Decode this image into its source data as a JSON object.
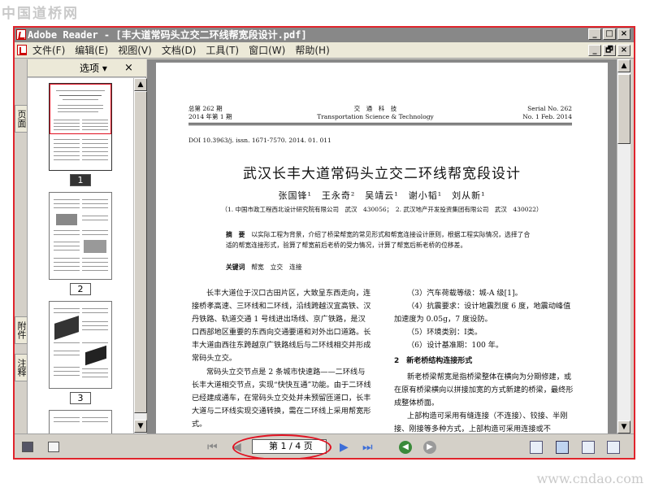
{
  "watermarks": {
    "top": "中国道桥网",
    "bottom": "www.cndao.com"
  },
  "window": {
    "title": "Adobe Reader - [丰大道常码头立交二环线帮宽段设计.pdf]",
    "title_buttons": [
      "_",
      "□",
      "×"
    ],
    "doc_buttons": [
      "_",
      "🗗",
      "×"
    ]
  },
  "menu": [
    "文件(F)",
    "编辑(E)",
    "视图(V)",
    "文档(D)",
    "工具(T)",
    "窗口(W)",
    "帮助(H)"
  ],
  "nav_tabs": [
    "页面",
    "附件",
    "注释"
  ],
  "nav_panel": {
    "options_label": "选项",
    "options_arrow": "▾",
    "close_label": "×",
    "thumbnail_labels": [
      "1",
      "2",
      "3"
    ]
  },
  "document": {
    "header_left": [
      "总第 262 期",
      "2014 年第 1 期"
    ],
    "header_center": [
      "交　通　科　技",
      "Transportation Science & Technology"
    ],
    "header_right": [
      "Serial No. 262",
      "No. 1 Feb. 2014"
    ],
    "doi": "DOI 10.3963/j. issn. 1671-7570. 2014. 01. 011",
    "title": "武汉长丰大道常码头立交二环线帮宽段设计",
    "authors": "张国锋¹　王永奇²　吴靖云¹　谢小韬¹　刘从新¹",
    "affiliation": "（1. 中国市政工程西北设计研究院有限公司　武汉　430056；　2. 武汉地产开发投资集团有限公司　武汉　430022）",
    "abstract_label": "摘　要",
    "abstract": "以实际工程为背景，介绍了桥梁帮宽的常见形式和帮宽连接设计原则，根据工程实际情况，选择了合适的帮宽连接形式，验算了帮宽前后老桥的受力情况，计算了帮宽后新老桥的位移差。",
    "keywords_label": "关键词",
    "keywords": "帮宽　立交　连接",
    "col1_paragraphs": [
      "长丰大道位于汉口古田片区，大致呈东西走向，连接桥孝高速、三环线和二环线，沿线跨越汉宜高铁、汉丹铁路、轨道交通 1 号线进出场线、京广铁路，是汉口西部地区重要的东西向交通要道和对外出口道路。长丰大道由西往东跨越京广铁路线后与二环线相交并形成常码头立交。",
      "常码头立交节点是 2 条城市快速路——二环线与长丰大道相交节点，实现“快快互通”功能。由于二环线已经建成通车，在常码头立交处并未预留匝道口，长丰大道与二环线实现交通转换，需在二环线上采用帮宽形式。"
    ],
    "col2_items": [
      "（3）汽车荷载等级：城-A 级[1]。",
      "（4）抗震要求：设计地震烈度 6 度，地震动峰值加速度为 0.05g，7 度设防。",
      "（5）环境类别：Ⅰ类。",
      "（6）设计基准期：100 年。"
    ],
    "col2_section": "2　新老桥结构连接形式",
    "col2_paragraphs": [
      "新老桥梁帮宽是指桥梁整体在横向为分期修建，或在原有桥梁横向以拼接加宽的方式新建的桥梁，最终形成整体桥面。",
      "上部构造可采用有缝连接（不连接）、铰接、半刚接、刚接等多种方式，上部构造可采用连接或不"
    ]
  },
  "statusbar": {
    "page_display": "第 1 / 4 页",
    "nav_glyphs": {
      "first": "⏮",
      "prev": "◀",
      "next": "▶",
      "last": "⏭",
      "back": "◀",
      "forward": "▶"
    }
  },
  "colors": {
    "highlight": "#e01020",
    "title_bar": "#888888",
    "chrome": "#d4d0c8"
  }
}
